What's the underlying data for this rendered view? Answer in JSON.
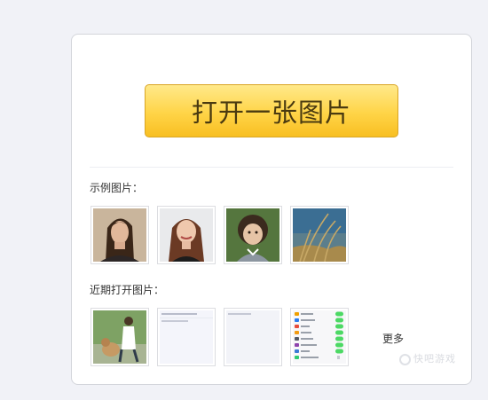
{
  "open_button": {
    "label": "打开一张图片"
  },
  "examples": {
    "label": "示例图片：",
    "items": [
      {
        "icon": "woman-portrait-brown-hair"
      },
      {
        "icon": "woman-portrait-smiling"
      },
      {
        "icon": "child-portrait"
      },
      {
        "icon": "grass-by-sea"
      }
    ]
  },
  "recent": {
    "label": "近期打开图片：",
    "items": [
      {
        "icon": "woman-with-dog"
      },
      {
        "icon": "screenshot-doc"
      },
      {
        "icon": "screenshot-blank"
      },
      {
        "icon": "screenshot-settings"
      }
    ],
    "more_label": "更多"
  },
  "watermark": {
    "text": "快吧游戏"
  },
  "colors": {
    "button_top": "#ffe98a",
    "button_bottom": "#f8bf22",
    "background": "#f1f2f7",
    "toggle_green": "#4cd964"
  }
}
